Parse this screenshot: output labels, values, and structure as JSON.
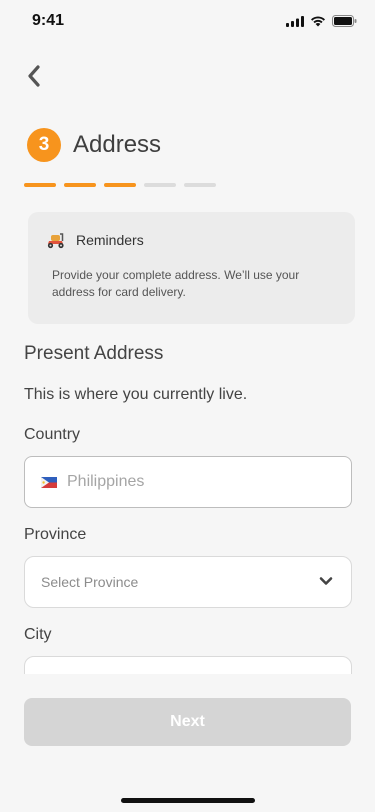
{
  "status": {
    "time": "9:41"
  },
  "icons": {
    "back": "chevron-left-icon",
    "reminder": "scooter-icon",
    "flag": "philippines-flag-icon",
    "chevron": "chevron-down-icon"
  },
  "step": {
    "number": "3",
    "title": "Address",
    "total": 5,
    "completed": 3
  },
  "colors": {
    "accent": "#f7941d",
    "inactive": "#dcdcdc",
    "disabled_button": "#d5d5d5"
  },
  "reminder": {
    "title": "Reminders",
    "text": "Provide your complete address. We’ll use your address for card delivery."
  },
  "section": {
    "title": "Present Address",
    "subtitle": "This is where you currently live."
  },
  "form": {
    "country_label": "Country",
    "country_value": "Philippines",
    "province_label": "Province",
    "province_placeholder": "Select Province",
    "city_label": "City"
  },
  "actions": {
    "next_label": "Next"
  }
}
